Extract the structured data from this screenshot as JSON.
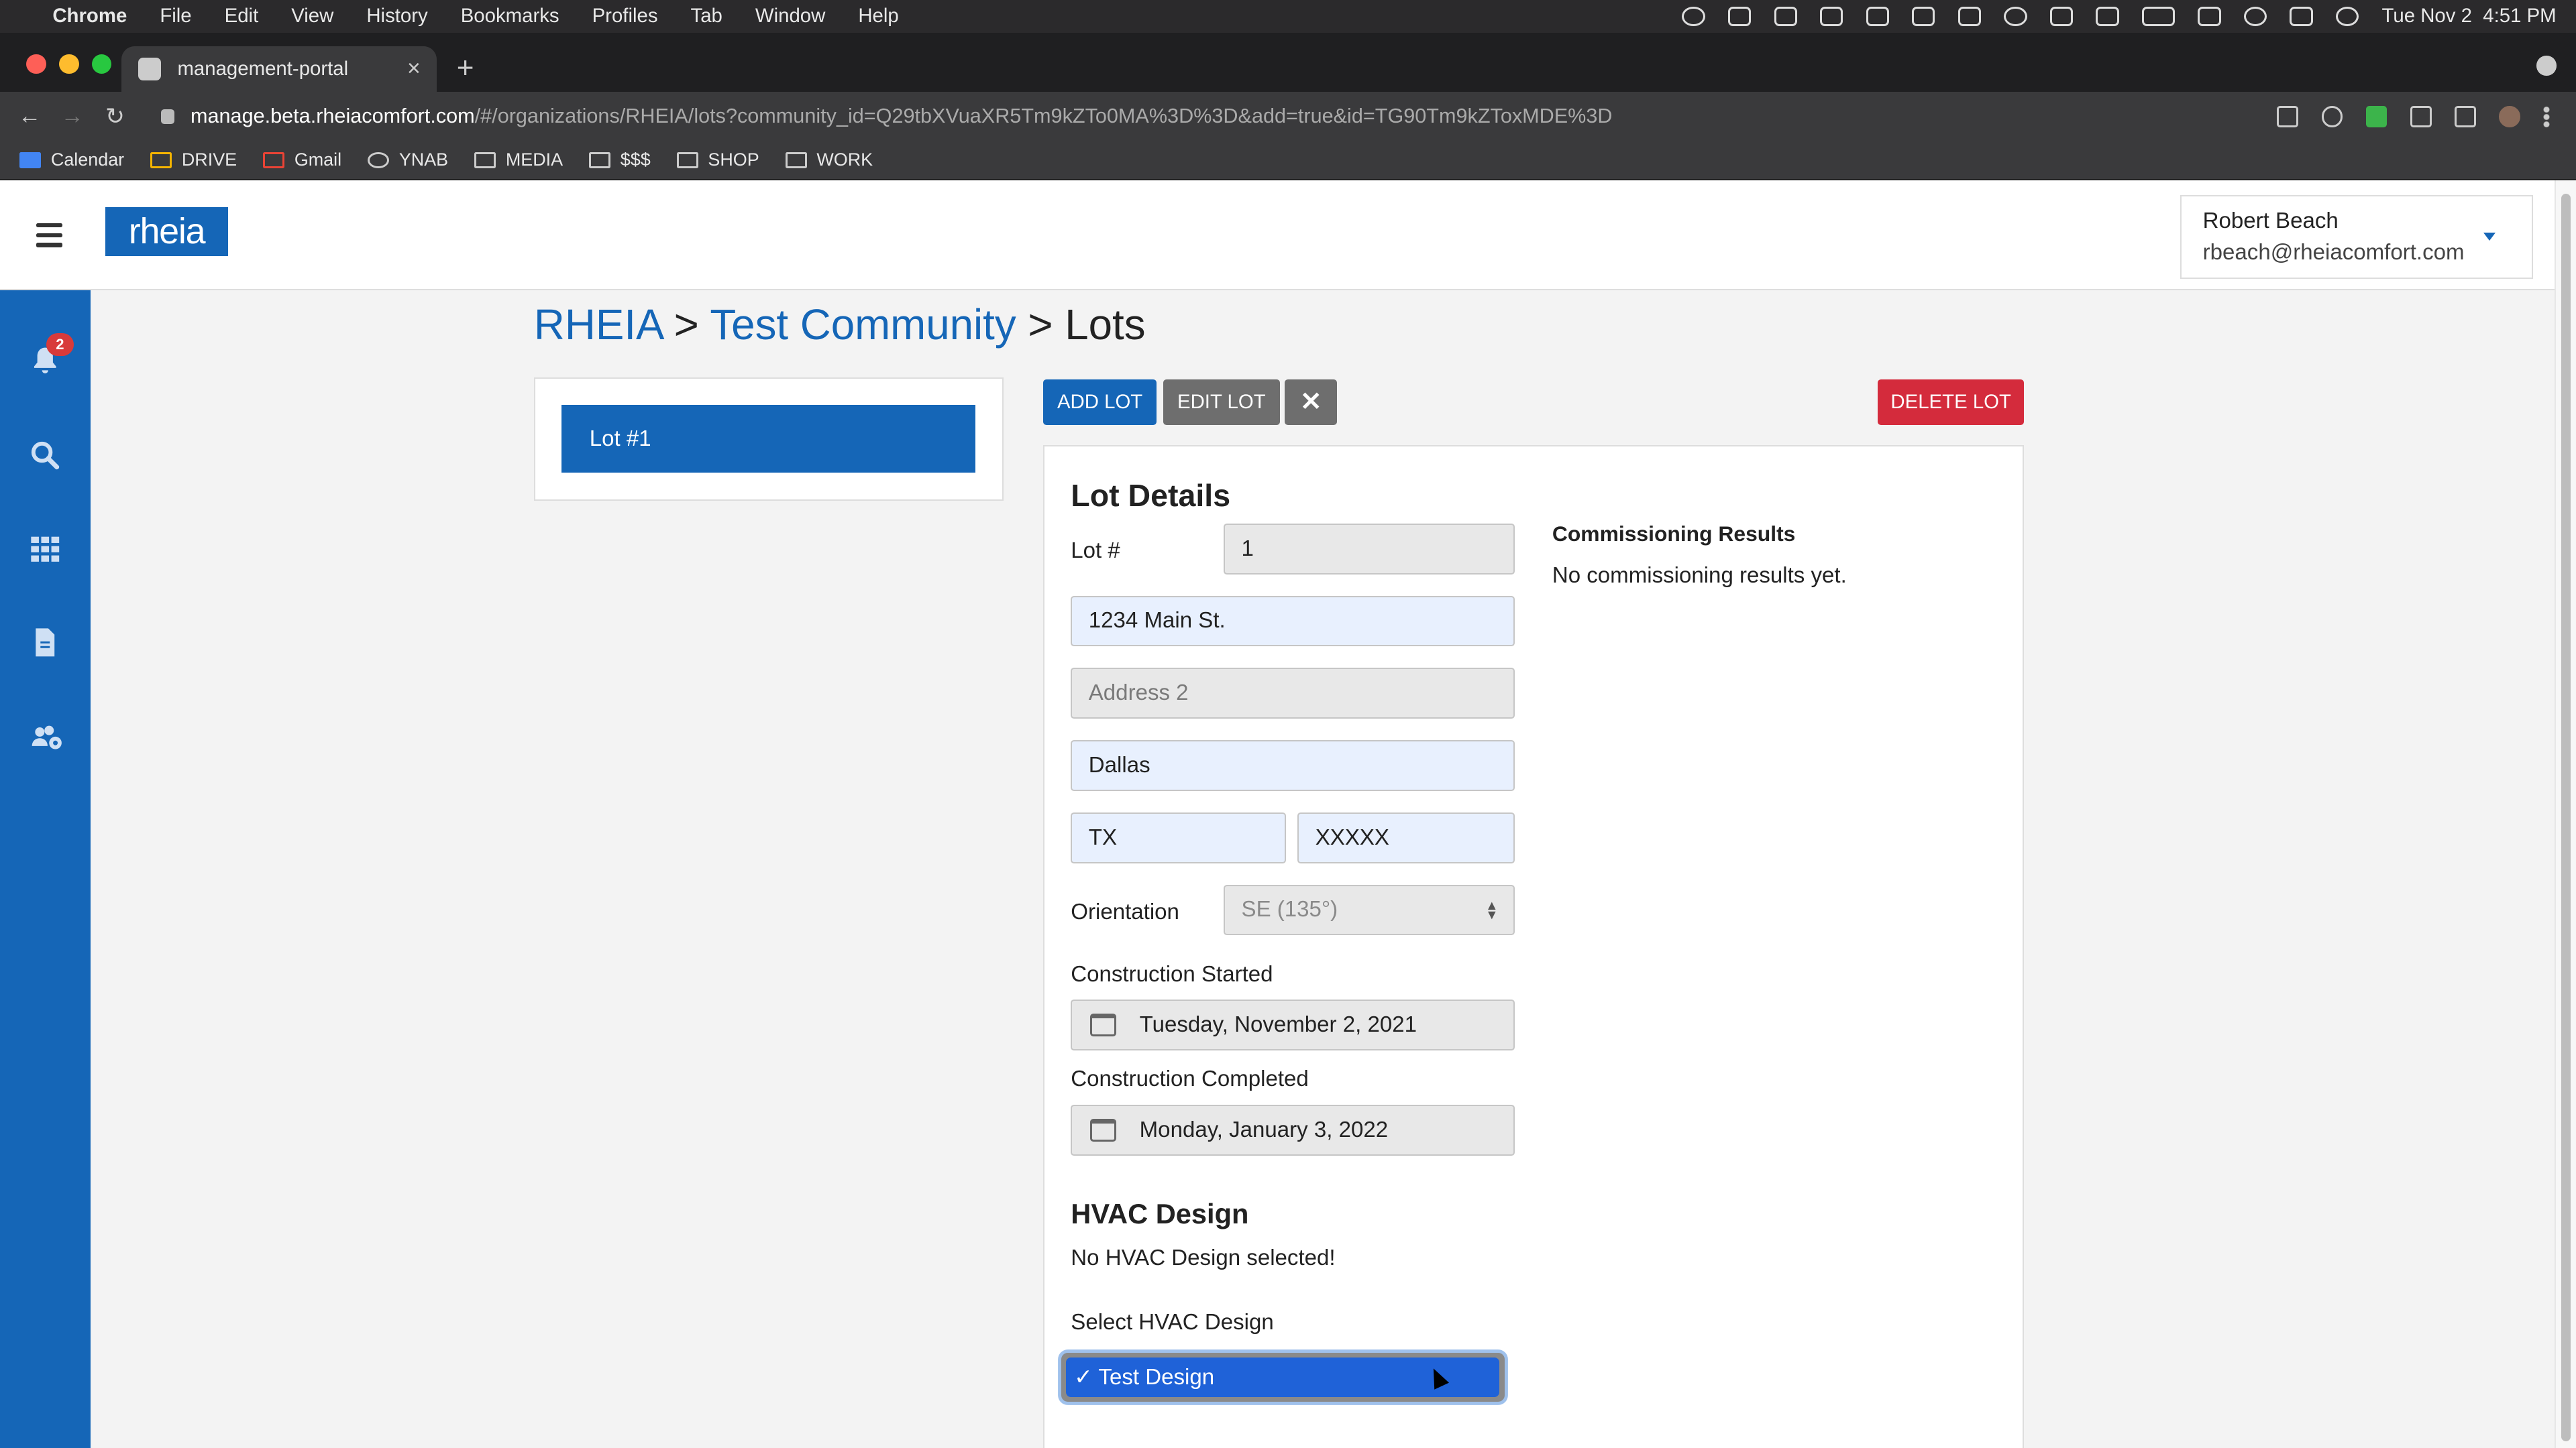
{
  "menubar": {
    "app": "Chrome",
    "menus": [
      "File",
      "Edit",
      "View",
      "History",
      "Bookmarks",
      "Profiles",
      "Tab",
      "Window",
      "Help"
    ],
    "clock": "Tue Nov 2  4:51 PM"
  },
  "browser": {
    "tab_title": "management-portal",
    "url_host": "manage.beta.rheiacomfort.com",
    "url_path": "/#/organizations/RHEIA/lots?community_id=Q29tbXVuaXR5Tm9kZTo0MA%3D%3D&add=true&id=TG90Tm9kZToxMDE%3D",
    "bookmarks": [
      "Calendar",
      "DRIVE",
      "Gmail",
      "YNAB",
      "MEDIA",
      "$$$",
      "SHOP",
      "WORK"
    ]
  },
  "app": {
    "logo": "rheia",
    "user_name": "Robert Beach",
    "user_email": "rbeach@rheiacomfort.com",
    "notifications_count": "2",
    "breadcrumb": {
      "org": "RHEIA",
      "sep1": " > ",
      "community": "Test Community",
      "sep2": " > ",
      "page": "Lots"
    },
    "lots": [
      "Lot #1"
    ],
    "buttons": {
      "add": "ADD LOT",
      "edit": "EDIT LOT",
      "close": "✕",
      "delete": "DELETE LOT"
    },
    "details": {
      "title": "Lot Details",
      "lot_label": "Lot #",
      "lot_value": "1",
      "address1": "1234 Main St.",
      "address2_placeholder": "Address 2",
      "city": "Dallas",
      "state": "TX",
      "zip": "XXXXX",
      "orientation_label": "Orientation",
      "orientation_value": "SE (135°)",
      "started_label": "Construction Started",
      "started_value": "Tuesday, November 2, 2021",
      "completed_label": "Construction Completed",
      "completed_value": "Monday, January 3, 2022",
      "hvac_title": "HVAC Design",
      "hvac_status": "No HVAC Design selected!",
      "hvac_select_label": "Select HVAC Design",
      "hvac_option": "✓ Test Design",
      "commissioning_title": "Commissioning Results",
      "commissioning_text": "No commissioning results yet."
    }
  }
}
